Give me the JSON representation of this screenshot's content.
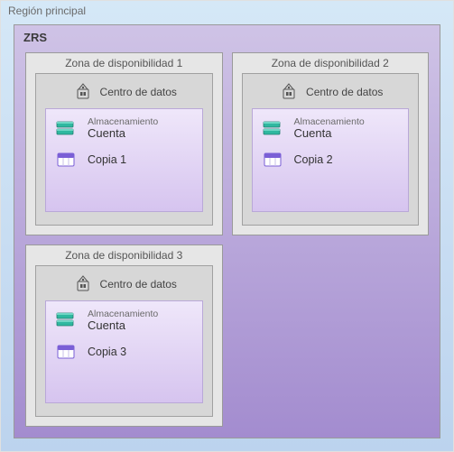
{
  "region_label": "Región principal",
  "zrs_label": "ZRS",
  "zones": [
    {
      "title": "Zona de disponibilidad 1",
      "datacenter_label": "Centro de datos",
      "storage_label_small": "Almacenamiento",
      "storage_label_big": "Cuenta",
      "copy_label": "Copia 1"
    },
    {
      "title": "Zona de disponibilidad 2",
      "datacenter_label": "Centro de datos",
      "storage_label_small": "Almacenamiento",
      "storage_label_big": "Cuenta",
      "copy_label": "Copia 2"
    },
    {
      "title": "Zona de disponibilidad 3",
      "datacenter_label": "Centro de datos",
      "storage_label_small": "Almacenamiento",
      "storage_label_big": "Cuenta",
      "copy_label": "Copia 3"
    }
  ]
}
